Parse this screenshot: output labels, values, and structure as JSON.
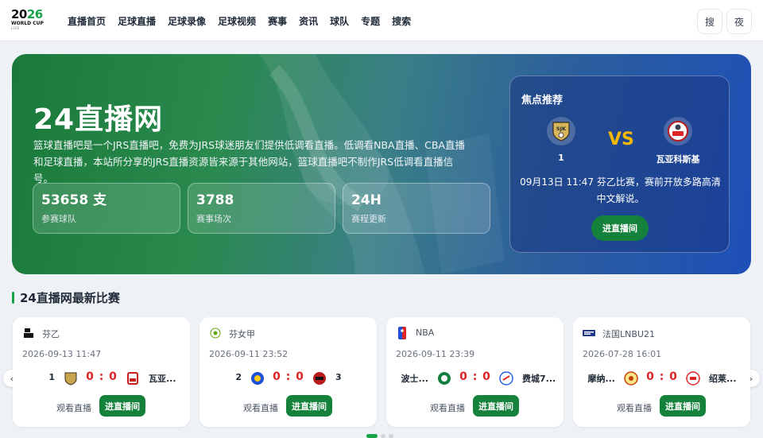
{
  "logo": {
    "year_a": "20",
    "year_b": "26",
    "line1": "WORLD CUP",
    "line2": "LIVE"
  },
  "nav": [
    "直播首页",
    "足球直播",
    "足球录像",
    "足球视频",
    "赛事",
    "资讯",
    "球队",
    "专题",
    "搜索"
  ],
  "header_buttons": {
    "search": "搜",
    "night": "夜"
  },
  "hero": {
    "title": "24直播网",
    "desc": "篮球直播吧是一个JRS直播吧，免费为JRS球迷朋友们提供低调看直播。低调看NBA直播、CBA直播和足球直播，本站所分享的JRS直播资源皆来源于其他网站，篮球直播吧不制作JRS低调看直播信号。",
    "stats": [
      {
        "value": "53658 支",
        "label": "参赛球队"
      },
      {
        "value": "3788",
        "label": "赛事场次"
      },
      {
        "value": "24H",
        "label": "赛程更新"
      }
    ]
  },
  "focus": {
    "title": "焦点推荐",
    "home": "1",
    "home_badge": "SJK",
    "vs": "VS",
    "away": "瓦亚科斯基",
    "info": "09月13日 11:47 芬乙比赛，赛前开放多路高清中文解说。",
    "button": "进直播间"
  },
  "section_title": "24直播网最新比赛",
  "matches": [
    {
      "league": "芬乙",
      "time": "2026-09-13 11:47",
      "home": "1",
      "away": "瓦亚...",
      "score": "0 : 0",
      "watch": "观看直播",
      "button": "进直播间",
      "home_color": "#6b5b3a",
      "away_color": "#c81e1e"
    },
    {
      "league": "芬女甲",
      "time": "2026-09-11 23:52",
      "home": "2",
      "away": "3",
      "score": "0 : 0",
      "watch": "观看直播",
      "button": "进直播间",
      "home_color": "#1d4fd8",
      "away_color": "#b91c1c"
    },
    {
      "league": "NBA",
      "time": "2026-09-11 23:39",
      "home": "波士...",
      "away": "费城7...",
      "score": "0 : 0",
      "watch": "观看直播",
      "button": "进直播间",
      "home_color": "#15803d",
      "away_color": "#2563eb"
    },
    {
      "league": "法国LNBU21",
      "time": "2026-07-28 16:01",
      "home": "摩纳...",
      "away": "绍莱...",
      "score": "0 : 0",
      "watch": "观看直播",
      "button": "进直播间",
      "home_color": "#c2410c",
      "away_color": "#dc2626"
    }
  ],
  "arrows": {
    "prev": "‹",
    "next": "›"
  },
  "colors": {
    "accent": "#16a34a",
    "score": "#dc2626",
    "vs": "#f5b800"
  }
}
